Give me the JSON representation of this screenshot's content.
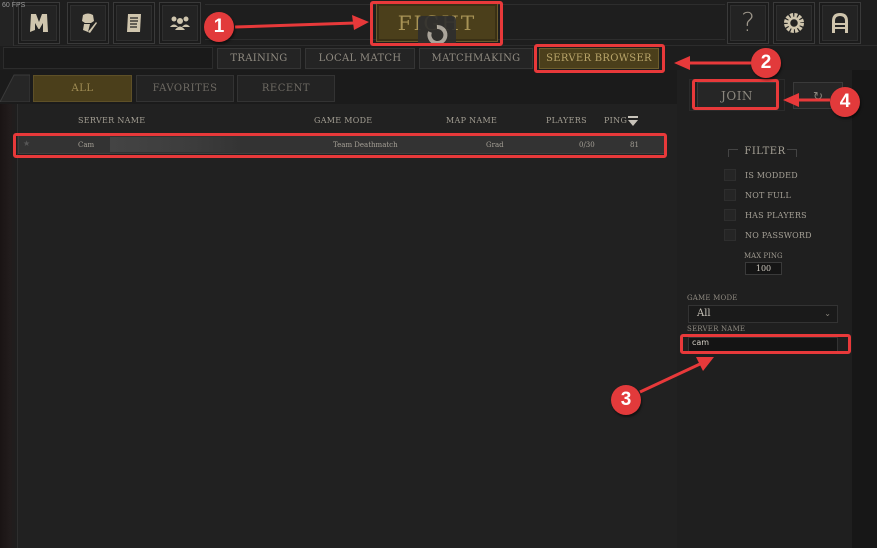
{
  "fps": "60 FPS",
  "top_nav": {
    "icons": [
      "main-menu-icon",
      "character-customize-icon",
      "scroll-log-icon",
      "social-group-icon"
    ],
    "right_icons": [
      "help-icon",
      "settings-icon",
      "exit-door-icon"
    ],
    "help_glyph": "?",
    "fight_label": "FIGHT"
  },
  "mode_tabs": [
    {
      "label": "TRAINING",
      "active": false
    },
    {
      "label": "LOCAL MATCH",
      "active": false
    },
    {
      "label": "MATCHMAKING",
      "active": false
    },
    {
      "label": "SERVER BROWSER",
      "active": true
    }
  ],
  "sub_tabs": [
    {
      "label": "ALL",
      "active": true
    },
    {
      "label": "FAVORITES",
      "active": false
    },
    {
      "label": "RECENT",
      "active": false
    }
  ],
  "table": {
    "columns": [
      "SERVER NAME",
      "GAME MODE",
      "MAP NAME",
      "PLAYERS",
      "PING"
    ],
    "rows": [
      {
        "favorite": "★",
        "server_name": "Cam",
        "game_mode": "Team Deathmatch",
        "map_name": "Grad",
        "players": "0/30",
        "ping": "81"
      }
    ]
  },
  "actions": {
    "join_label": "JOIN",
    "refresh_glyph": "↻"
  },
  "filter": {
    "title": "FILTER",
    "options": [
      {
        "label": "IS MODDED",
        "checked": false
      },
      {
        "label": "NOT FULL",
        "checked": false
      },
      {
        "label": "HAS PLAYERS",
        "checked": false
      },
      {
        "label": "NO PASSWORD",
        "checked": false
      }
    ],
    "max_ping_label": "MAX PING",
    "max_ping_value": "100",
    "game_mode_label": "GAME MODE",
    "game_mode_value": "All",
    "server_name_label": "SERVER NAME",
    "server_name_value": "cam"
  },
  "annotations": {
    "badges": [
      "1",
      "2",
      "3",
      "4"
    ],
    "color": "#e8393a"
  },
  "colors": {
    "active_gold": "#4b3f1b",
    "gold_text": "#b9a56a",
    "panel_bg": "#212121"
  }
}
